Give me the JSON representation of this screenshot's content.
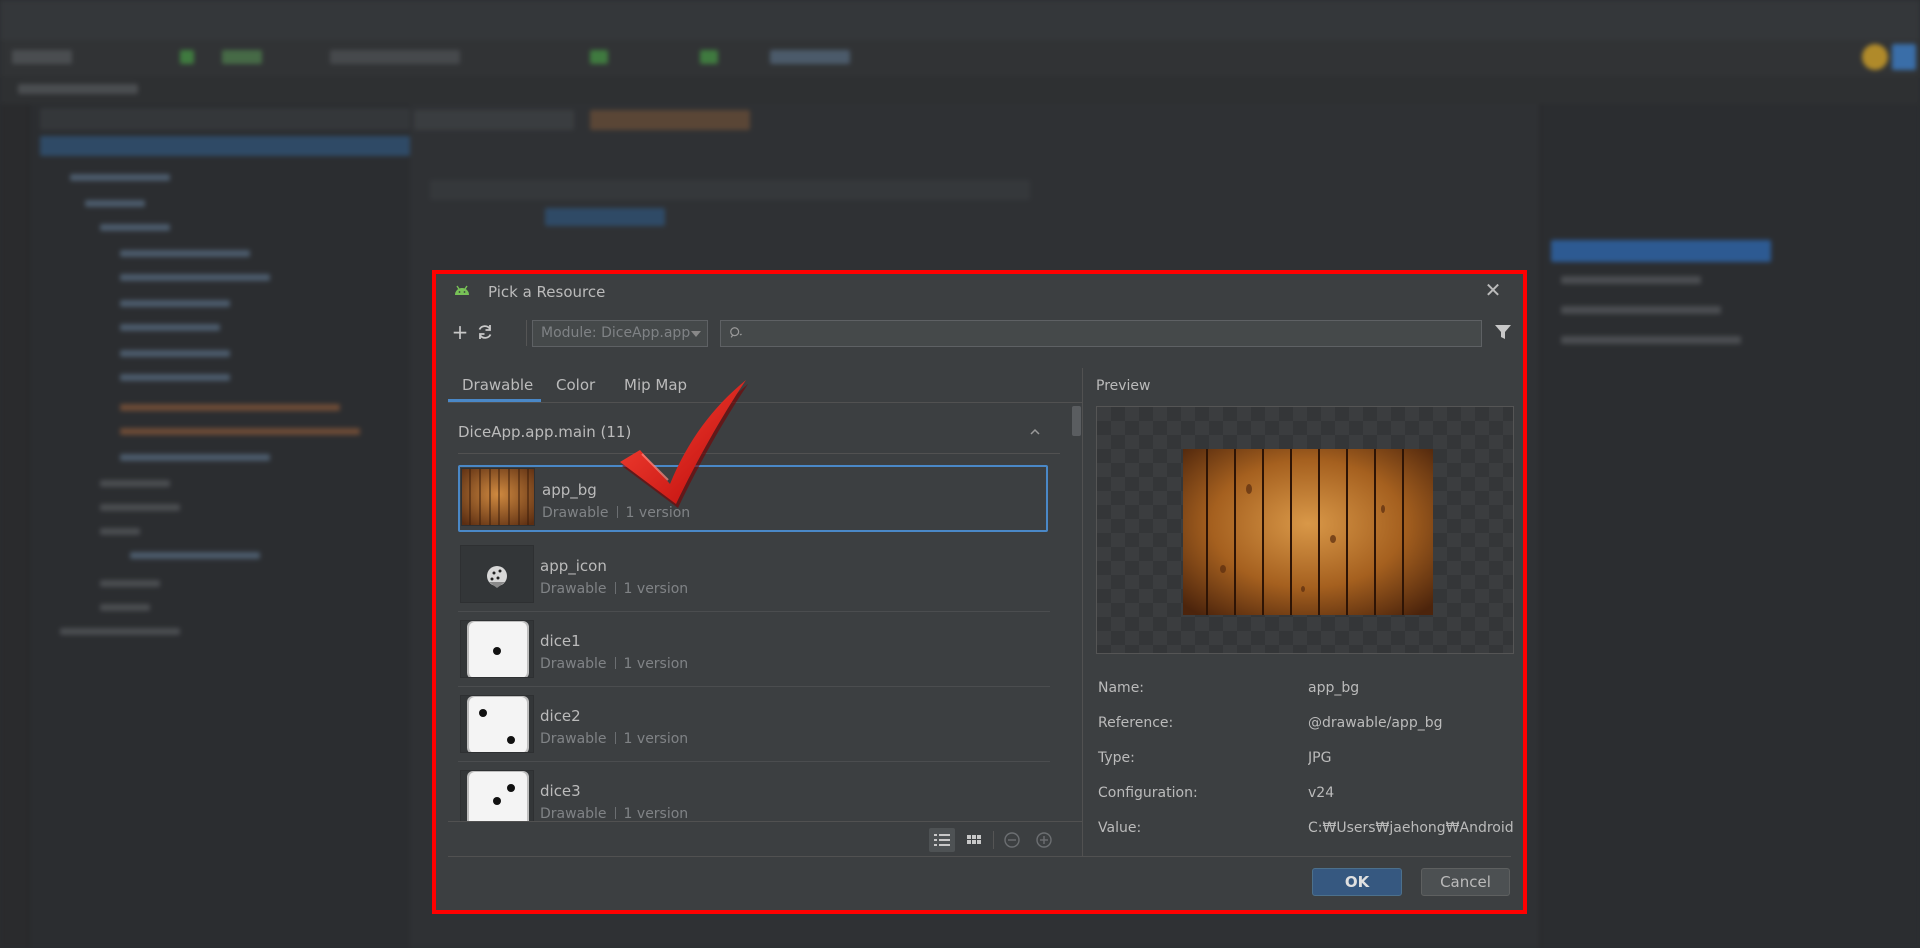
{
  "dialog": {
    "title": "Pick a Resource",
    "module_select": "Module: DiceApp.app",
    "search_placeholder": "",
    "tabs": [
      {
        "label": "Drawable",
        "active": true
      },
      {
        "label": "Color",
        "active": false
      },
      {
        "label": "Mip Map",
        "active": false
      }
    ],
    "group_header": "DiceApp.app.main (11)",
    "resources": [
      {
        "name": "app_bg",
        "type": "Drawable",
        "versions": "1 version",
        "selected": true
      },
      {
        "name": "app_icon",
        "type": "Drawable",
        "versions": "1 version",
        "selected": false
      },
      {
        "name": "dice1",
        "type": "Drawable",
        "versions": "1 version",
        "selected": false
      },
      {
        "name": "dice2",
        "type": "Drawable",
        "versions": "1 version",
        "selected": false
      },
      {
        "name": "dice3",
        "type": "Drawable",
        "versions": "1 version",
        "selected": false
      }
    ],
    "preview": {
      "label": "Preview",
      "properties": [
        {
          "key": "Name:",
          "value": "app_bg"
        },
        {
          "key": "Reference:",
          "value": "@drawable/app_bg"
        },
        {
          "key": "Type:",
          "value": "JPG"
        },
        {
          "key": "Configuration:",
          "value": "v24"
        },
        {
          "key": "Value:",
          "value": "C:₩Users₩jaehong₩Android..."
        }
      ]
    },
    "buttons": {
      "ok": "OK",
      "cancel": "Cancel"
    }
  },
  "colors": {
    "dialog_bg": "#3c3f41",
    "highlight_border": "#ff0000",
    "selection_border": "#4a88c7",
    "ok_button": "#365880",
    "checkmark": "#e01010"
  },
  "icons": [
    "android-icon",
    "close-icon",
    "add-icon",
    "refresh-icon",
    "search-icon",
    "filter-icon",
    "chevron-up-icon",
    "list-view-icon",
    "grid-view-icon",
    "zoom-out-icon",
    "zoom-in-icon",
    "checkmark-annotation"
  ]
}
